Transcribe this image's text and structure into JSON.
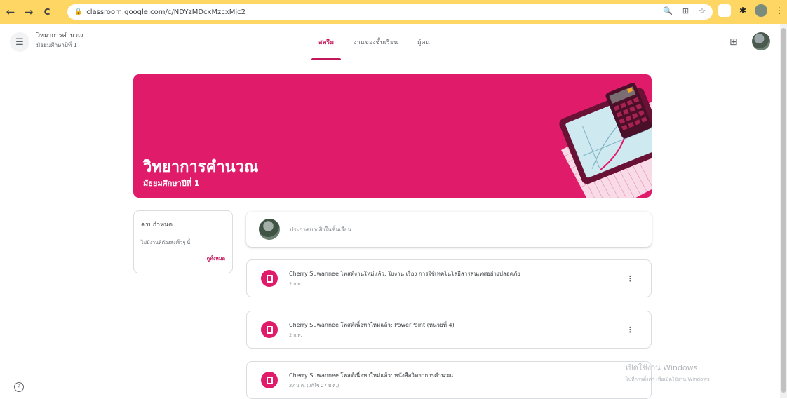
{
  "browser": {
    "url": "classroom.google.com/c/NDYzMDcxMzcxMjc2",
    "back": "←",
    "forward": "→",
    "reload": "C"
  },
  "header": {
    "class_name": "วิทยาการคำนวณ",
    "class_section": "มัธยมศึกษาปีที่ 1",
    "tabs": [
      {
        "label": "สตรีม",
        "active": true
      },
      {
        "label": "งานของชั้นเรียน",
        "active": false
      },
      {
        "label": "ผู้คน",
        "active": false
      }
    ]
  },
  "banner": {
    "title": "วิทยาการคำนวณ",
    "subtitle": "มัธยมศึกษาปีที่ 1",
    "color": "#e01b6a"
  },
  "upcoming": {
    "heading": "ครบกำหนด",
    "body": "ไม่มีงานที่ต้องส่งเร็วๆ นี้",
    "link": "ดูทั้งหมด"
  },
  "composer": {
    "placeholder": "ประกาศบางสิ่งในชั้นเรียน"
  },
  "stream": [
    {
      "title": "Cherry Suwannee โพสต์งานใหม่แล้ว: ใบงาน เรื่อง การใช้เทคโนโลยีสารสนเทศอย่างปลอดภัย",
      "date": "2 ก.พ."
    },
    {
      "title": "Cherry Suwannee โพสต์เนื้อหาใหม่แล้ว: PowerPoint (หน่วยที่ 4)",
      "date": "2 ก.พ."
    },
    {
      "title": "Cherry Suwannee โพสต์เนื้อหาใหม่แล้ว: หนังสือวิทยาการคำนวณ",
      "date": "27 ม.ค. (แก้ไข 27 ม.ค.)"
    }
  ],
  "watermark": {
    "line1": "เปิดใช้งาน Windows",
    "line2": "ไปที่การตั้งค่า เพื่อเปิดใช้งาน Windows"
  },
  "colors": {
    "accent": "#c2185b",
    "banner": "#e01b6a",
    "browser_bar": "#fdd663"
  }
}
